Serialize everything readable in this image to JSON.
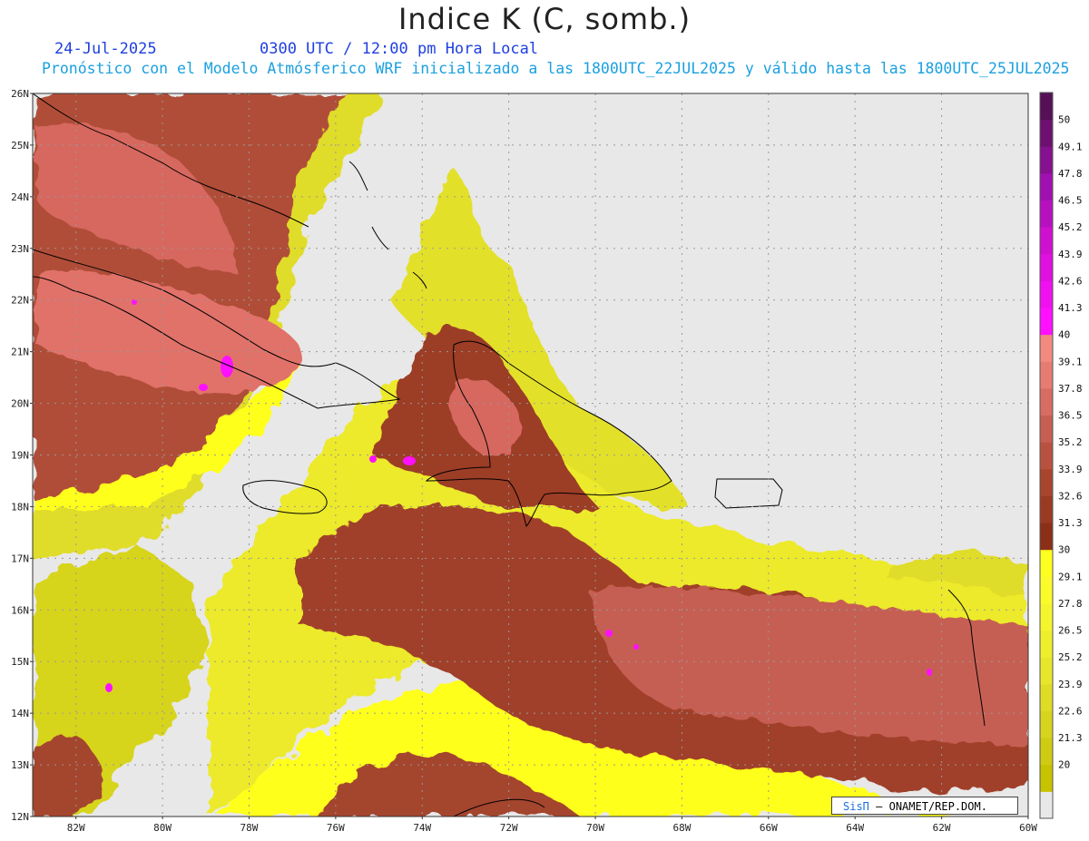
{
  "title": "Indice K (C, somb.)",
  "date": "24-Jul-2025",
  "utc_local": "0300 UTC / 12:00 pm Hora Local",
  "model_line": "Pronóstico con el Modelo Atmósferico WRF inicializado a las 1800UTC_22JUL2025 y válido hasta las  1800UTC_25JUL2025",
  "credit": {
    "brand": "SisΠ",
    "text": "– ONAMET/REP.DOM."
  },
  "map": {
    "lon_min": -83,
    "lon_max": -60,
    "lat_min": 12,
    "lat_max": 26,
    "lat_ticks": [
      "12N",
      "13N",
      "14N",
      "15N",
      "16N",
      "17N",
      "18N",
      "19N",
      "20N",
      "21N",
      "22N",
      "23N",
      "24N",
      "25N",
      "26N"
    ],
    "lon_ticks": [
      "82W",
      "80W",
      "78W",
      "76W",
      "74W",
      "72W",
      "70W",
      "68W",
      "66W",
      "64W",
      "62W",
      "60W"
    ]
  },
  "colorbar": {
    "levels": [
      {
        "label": "",
        "color": "#e8e8e8"
      },
      {
        "label": "20",
        "color": "#c8c300"
      },
      {
        "label": "21.3",
        "color": "#cfcb12"
      },
      {
        "label": "22.6",
        "color": "#d7d41f"
      },
      {
        "label": "23.9",
        "color": "#dfdc26"
      },
      {
        "label": "25.2",
        "color": "#e8e62a"
      },
      {
        "label": "26.5",
        "color": "#efee2d"
      },
      {
        "label": "27.8",
        "color": "#f5f52e"
      },
      {
        "label": "29.1",
        "color": "#fbfb2c"
      },
      {
        "label": "30",
        "color": "#ffff1f"
      },
      {
        "label": "31.3",
        "color": "#8a3018"
      },
      {
        "label": "32.6",
        "color": "#9a3a22"
      },
      {
        "label": "33.9",
        "color": "#a8452d"
      },
      {
        "label": "35.2",
        "color": "#b85240"
      },
      {
        "label": "36.5",
        "color": "#c65e52"
      },
      {
        "label": "37.8",
        "color": "#d86b62"
      },
      {
        "label": "39.1",
        "color": "#e67b72"
      },
      {
        "label": "40",
        "color": "#f28a80"
      },
      {
        "label": "41.3",
        "color": "#ff10ff"
      },
      {
        "label": "42.6",
        "color": "#f010f0"
      },
      {
        "label": "43.9",
        "color": "#e010e0"
      },
      {
        "label": "45.2",
        "color": "#d010d0"
      },
      {
        "label": "46.5",
        "color": "#b810c0"
      },
      {
        "label": "47.8",
        "color": "#a010b0"
      },
      {
        "label": "49.1",
        "color": "#86108f"
      },
      {
        "label": "50",
        "color": "#6e1070"
      },
      {
        "label": "",
        "color": "#561058"
      }
    ]
  },
  "colors": {
    "land_line": "#000000",
    "grid": "#999999"
  }
}
